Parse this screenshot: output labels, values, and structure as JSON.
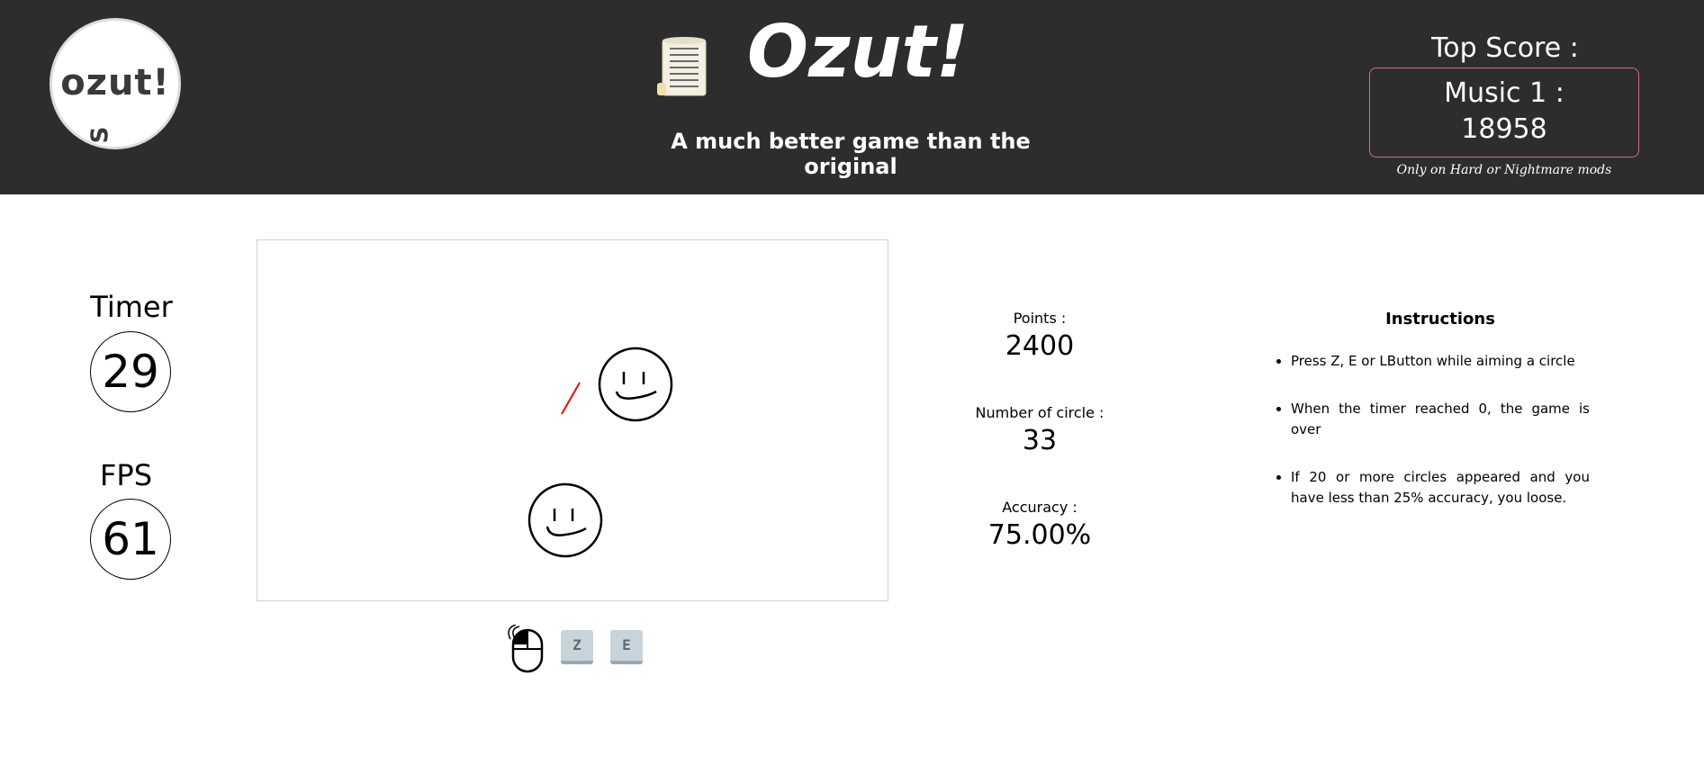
{
  "header": {
    "logo_text": "ozut!",
    "logo_subtext": "S",
    "title": "Ozut!",
    "subtitle": "A much better game than the original",
    "top_score": {
      "label": "Top Score :",
      "music": "Music 1 :",
      "value": "18958",
      "note": "Only on Hard or Nightmare mods"
    },
    "icons": {
      "scroll": "scroll-icon"
    }
  },
  "left_panel": {
    "timer_label": "Timer",
    "timer_value": "29",
    "fps_label": "FPS",
    "fps_value": "61"
  },
  "game": {
    "targets": [
      "smiley-target-1",
      "smiley-target-2"
    ],
    "line_color": "#ff0000"
  },
  "controls": {
    "mouse_icon": "mouse-left-button-icon",
    "keys": [
      "Z",
      "E"
    ]
  },
  "stats": {
    "points_label": "Points :",
    "points_value": "2400",
    "circles_label": "Number of circle :",
    "circles_value": "33",
    "accuracy_label": "Accuracy :",
    "accuracy_value": "75.00%"
  },
  "instructions": {
    "title": "Instructions",
    "items": [
      "Press Z, E or LButton while aiming a circle",
      "When the timer reached 0, the game is over",
      "If 20 or more circles appeared and you have less than 25% accuracy, you loose."
    ]
  },
  "colors": {
    "header_bg": "#2d2d2d",
    "top_score_border": "#c9727a",
    "key_bg": "#c7d4dc"
  }
}
